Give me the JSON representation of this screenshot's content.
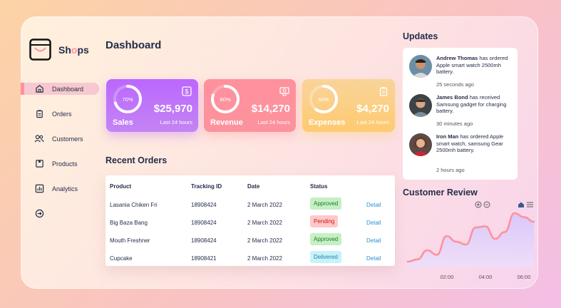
{
  "brand": {
    "name_prefix": "Sh",
    "name_accent": "o",
    "name_suffix": "ps"
  },
  "sidebar": {
    "items": [
      {
        "label": "Dashboard",
        "icon": "home-icon",
        "active": true
      },
      {
        "label": "Orders",
        "icon": "clipboard-icon"
      },
      {
        "label": "Customers",
        "icon": "users-icon"
      },
      {
        "label": "Products",
        "icon": "package-icon"
      },
      {
        "label": "Analytics",
        "icon": "chart-icon"
      }
    ],
    "logout_icon": "signout-icon"
  },
  "page_title": "Dashboard",
  "cards": [
    {
      "title": "Sales",
      "percent": "70%",
      "percent_value": 70,
      "value": "$25,970",
      "period": "Last 24 hours",
      "color": "#bb67ff",
      "icon": "dollar-icon"
    },
    {
      "title": "Revenue",
      "percent": "80%",
      "percent_value": 80,
      "value": "$14,270",
      "period": "Last 24 hours",
      "color": "#ff919d",
      "icon": "money-icon"
    },
    {
      "title": "Expenses",
      "percent": "60%",
      "percent_value": 60,
      "value": "$4,270",
      "period": "Last 24 hours",
      "color": "#f9d59b",
      "icon": "clipboard-icon"
    }
  ],
  "recent_orders": {
    "title": "Recent Orders",
    "columns": [
      "Product",
      "Tracking ID",
      "Date",
      "Status"
    ],
    "rows": [
      {
        "product": "Lasania Chiken Fri",
        "tracking": "18908424",
        "date": "2 March 2022",
        "status": "Approved",
        "action": "Detail"
      },
      {
        "product": "Big Baza Bang",
        "tracking": "18908424",
        "date": "2 March 2022",
        "status": "Pending",
        "action": "Detail"
      },
      {
        "product": "Mouth Freshner",
        "tracking": "18908424",
        "date": "2 March 2022",
        "status": "Approved",
        "action": "Detail"
      },
      {
        "product": "Cupcake",
        "tracking": "18908421",
        "date": "2 March 2022",
        "status": "Delivered",
        "action": "Detail"
      }
    ]
  },
  "updates": {
    "title": "Updates",
    "items": [
      {
        "name": "Andrew Thomas",
        "text": " has ordered Apple smart watch 2500mh battery.",
        "time": "25 seconds ago"
      },
      {
        "name": "James Bond",
        "text": " has received Samsung gadget for charging battery.",
        "time": "30 minutes ago"
      },
      {
        "name": "Iron Man",
        "text": " has ordered Apple smart watch, samsung Gear 2500mh battery.",
        "time": "2 hours ago"
      }
    ]
  },
  "customer_review": {
    "title": "Customer Review",
    "toolbar_icons": [
      "zoom-in-icon",
      "zoom-out-icon",
      "home-icon",
      "menu-icon"
    ]
  },
  "chart_data": {
    "type": "area",
    "x_ticks": [
      "02:00",
      "04:00",
      "06:00"
    ],
    "x": [
      0,
      0.5,
      1,
      1.5,
      2,
      2.5,
      3,
      3.5,
      4,
      4.5,
      5,
      5.5,
      6,
      6.5
    ],
    "values": [
      10,
      14,
      30,
      22,
      55,
      45,
      40,
      70,
      72,
      50,
      62,
      95,
      88,
      80
    ],
    "ylim": [
      0,
      100
    ],
    "color": "#ff919d",
    "fill": "#d8c8fa"
  }
}
